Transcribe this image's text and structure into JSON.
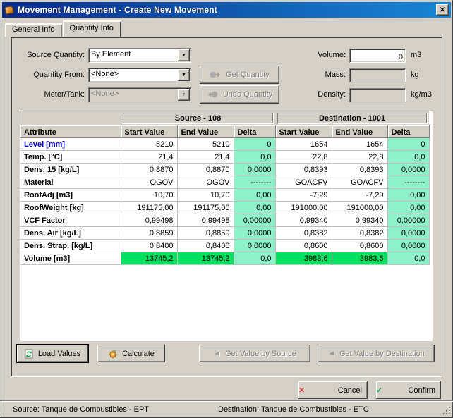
{
  "window": {
    "title": "Movement Management - Create New Movement",
    "close_glyph": "✕"
  },
  "tabs": [
    {
      "label": "General Info"
    },
    {
      "label": "Quantity Info"
    }
  ],
  "form": {
    "source_quantity": {
      "label": "Source Quantity:",
      "value": "By Element"
    },
    "quantity_from": {
      "label": "Quantity From:",
      "value": "<None>"
    },
    "meter_tank": {
      "label": "Meter/Tank:",
      "value": "<None>"
    },
    "get_quantity_label": "Get Quantity",
    "undo_quantity_label": "Undo Quantity",
    "volume": {
      "label": "Volume:",
      "value": "0",
      "unit": "m3"
    },
    "mass": {
      "label": "Mass:",
      "value": "",
      "unit": "kg"
    },
    "density": {
      "label": "Density:",
      "value": "",
      "unit": "kg/m3"
    }
  },
  "table": {
    "groups": [
      "Source - 108",
      "Destination - 1001"
    ],
    "columns": [
      "Attribute",
      "Start Value",
      "End Value",
      "Delta",
      "Start Value",
      "End Value",
      "Delta"
    ],
    "rows": [
      {
        "label": "Level [mm]",
        "blue": true,
        "cells": [
          "5210",
          "5210",
          "0",
          "1654",
          "1654",
          "0"
        ]
      },
      {
        "label": "Temp. [°C]",
        "cells": [
          "21,4",
          "21,4",
          "0,0",
          "22,8",
          "22,8",
          "0,0"
        ]
      },
      {
        "label": "Dens. 15 [kg/L]",
        "cells": [
          "0,8870",
          "0,8870",
          "0,0000",
          "0,8393",
          "0,8393",
          "0,0000"
        ]
      },
      {
        "label": "Material",
        "cells": [
          "OGOV",
          "OGOV",
          "--------",
          "GOACFV",
          "GOACFV",
          "--------"
        ]
      },
      {
        "label": "RoofAdj [m3]",
        "cells": [
          "10,70",
          "10,70",
          "0,00",
          "-7,29",
          "-7,29",
          "0,00"
        ]
      },
      {
        "label": "RoofWeight [kg]",
        "cells": [
          "191175,00",
          "191175,00",
          "0,00",
          "191000,00",
          "191000,00",
          "0,00"
        ]
      },
      {
        "label": "VCF Factor",
        "cells": [
          "0,99498",
          "0,99498",
          "0,00000",
          "0,99340",
          "0,99340",
          "0,00000"
        ]
      },
      {
        "label": "Dens. Air [kg/L]",
        "cells": [
          "0,8859",
          "0,8859",
          "0,0000",
          "0,8382",
          "0,8382",
          "0,0000"
        ]
      },
      {
        "label": "Dens. Strap. [kg/L]",
        "cells": [
          "0,8400",
          "0,8400",
          "0,0000",
          "0,8600",
          "0,8600",
          "0,0000"
        ]
      },
      {
        "label": "Volume [m3]",
        "volume": true,
        "cells": [
          "13745,2",
          "13745,2",
          "0,0",
          "3983,6",
          "3983,6",
          "0,0"
        ]
      }
    ]
  },
  "actions": {
    "load_values": "Load Values",
    "calculate": "Calculate",
    "get_value_by_source": "Get Value by Source",
    "get_value_by_destination": "Get Value by Destination"
  },
  "footer": {
    "cancel": "Cancel",
    "confirm": "Confirm"
  },
  "statusbar": {
    "source": "Source: Tanque de Combustibles - EPT",
    "destination": "Destination: Tanque de Combustibles - ETC"
  },
  "colors": {
    "title_gradient_left": "#0a2a8a",
    "title_gradient_right": "#1787d8",
    "delta_bg": "#8df0c8",
    "volume_highlight_bg": "#00e060",
    "level_label_color": "#0000c8"
  }
}
